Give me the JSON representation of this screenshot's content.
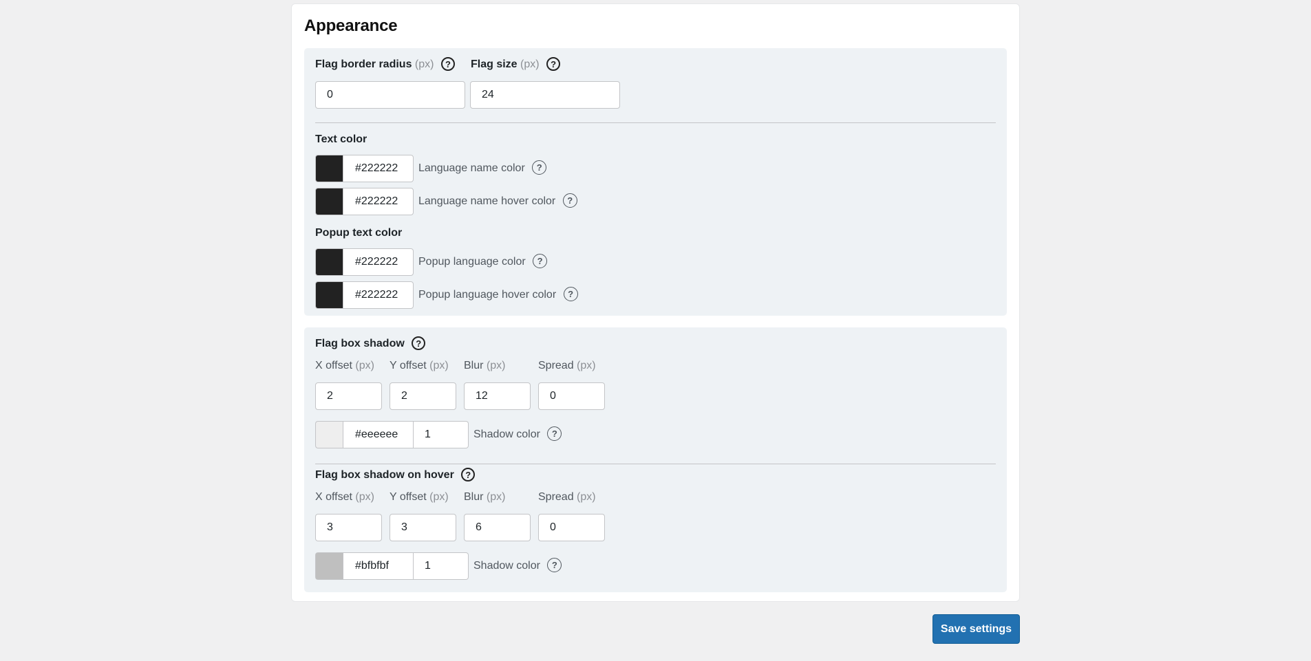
{
  "section": {
    "title": "Appearance"
  },
  "flag": {
    "border_radius_label": "Flag border radius",
    "size_label": "Flag size",
    "unit": "(px)",
    "border_radius_value": "0",
    "size_value": "24"
  },
  "text_color": {
    "heading": "Text color",
    "rows": [
      {
        "value": "#222222",
        "swatch": "#222222",
        "label": "Language name color"
      },
      {
        "value": "#222222",
        "swatch": "#222222",
        "label": "Language name hover color"
      }
    ]
  },
  "popup_text_color": {
    "heading": "Popup text color",
    "rows": [
      {
        "value": "#222222",
        "swatch": "#222222",
        "label": "Popup language color"
      },
      {
        "value": "#222222",
        "swatch": "#222222",
        "label": "Popup language hover color"
      }
    ]
  },
  "shadow": {
    "heading": "Flag box shadow",
    "labels": {
      "x": "X offset",
      "y": "Y offset",
      "blur": "Blur",
      "spread": "Spread",
      "unit": "(px)"
    },
    "values": {
      "x": "2",
      "y": "2",
      "blur": "12",
      "spread": "0"
    },
    "color": {
      "value": "#eeeeee",
      "swatch": "#eeeeee",
      "opacity": "1",
      "label": "Shadow color"
    }
  },
  "shadow_hover": {
    "heading": "Flag box shadow on hover",
    "labels": {
      "x": "X offset",
      "y": "Y offset",
      "blur": "Blur",
      "spread": "Spread",
      "unit": "(px)"
    },
    "values": {
      "x": "3",
      "y": "3",
      "blur": "6",
      "spread": "0"
    },
    "color": {
      "value": "#bfbfbf",
      "swatch": "#bfbfbf",
      "opacity": "1",
      "label": "Shadow color"
    }
  },
  "help_glyph": "?",
  "actions": {
    "save_label": "Save settings"
  }
}
